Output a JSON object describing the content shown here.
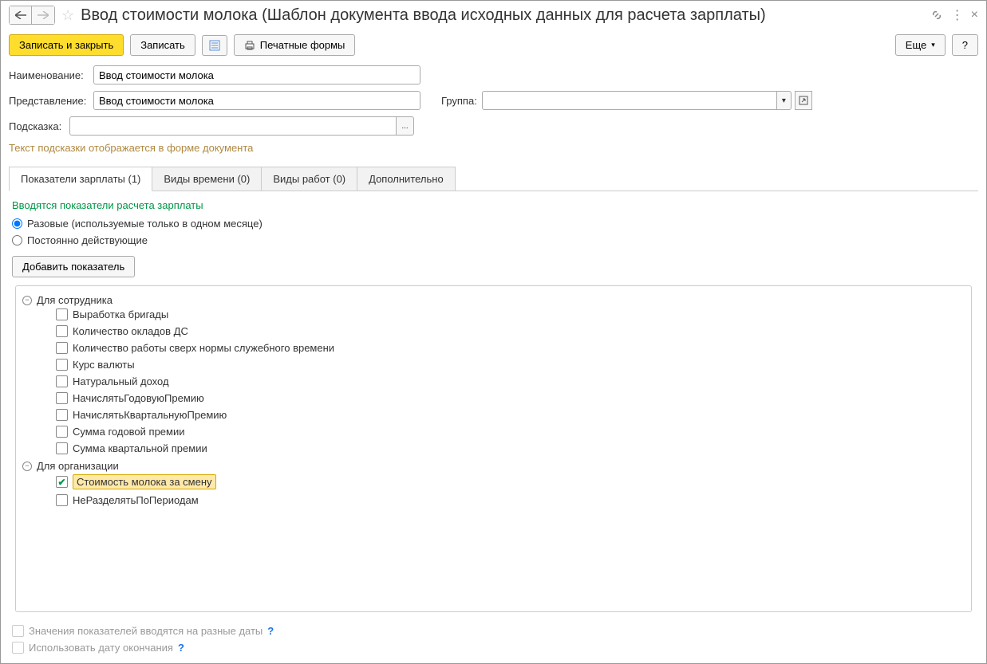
{
  "title": "Ввод стоимости молока (Шаблон документа ввода исходных данных для расчета зарплаты)",
  "toolbar": {
    "save_close": "Записать и закрыть",
    "save": "Записать",
    "print": "Печатные формы",
    "more": "Еще",
    "help": "?"
  },
  "form": {
    "name_label": "Наименование:",
    "name_value": "Ввод стоимости молока",
    "repr_label": "Представление:",
    "repr_value": "Ввод стоимости молока",
    "group_label": "Группа:",
    "group_value": "",
    "hint_label": "Подсказка:",
    "hint_value": "",
    "hint_help": "Текст подсказки отображается в форме документа"
  },
  "tabs": {
    "t0": "Показатели зарплаты (1)",
    "t1": "Виды времени (0)",
    "t2": "Виды работ (0)",
    "t3": "Дополнительно"
  },
  "section": {
    "title": "Вводятся показатели расчета зарплаты",
    "radio_once": "Разовые (используемые только в одном месяце)",
    "radio_perm": "Постоянно действующие",
    "add_btn": "Добавить показатель"
  },
  "tree": {
    "g0": {
      "label": "Для сотрудника",
      "i0": "Выработка бригады",
      "i1": "Количество окладов ДС",
      "i2": "Количество работы сверх нормы служебного времени",
      "i3": "Курс валюты",
      "i4": "Натуральный доход",
      "i5": "НачислятьГодовуюПремию",
      "i6": "НачислятьКвартальнуюПремию",
      "i7": "Сумма годовой премии",
      "i8": "Сумма квартальной премии"
    },
    "g1": {
      "label": "Для организации",
      "i0": "Стоимость молока за смену",
      "i1": "НеРазделятьПоПериодам"
    }
  },
  "bottom": {
    "c0": "Значения показателей вводятся на разные даты",
    "c1": "Использовать дату окончания"
  }
}
